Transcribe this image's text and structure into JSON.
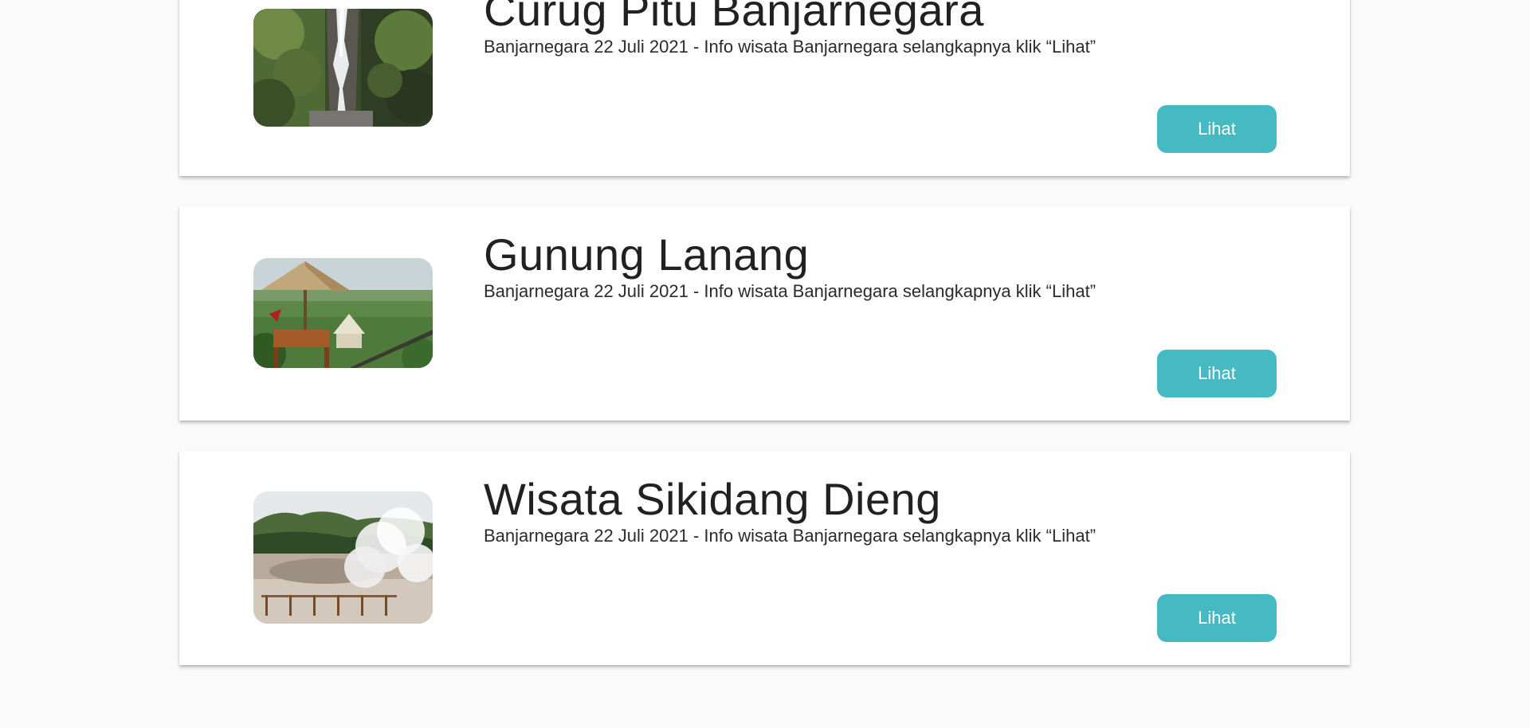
{
  "colors": {
    "page_background": "#fafafa",
    "card_background": "#ffffff",
    "button_background": "#45bac2",
    "button_text": "#ffffff",
    "title_text": "#212121"
  },
  "cards": [
    {
      "title": "Curug Pitu Banjarnegara",
      "subtitle": "Banjarnegara 22 Juli 2021 - Info wisata Banjarnegara selangkapnya klik “Lihat”",
      "button_label": "Lihat",
      "image_subject": "waterfall"
    },
    {
      "title": "Gunung Lanang",
      "subtitle": "Banjarnegara 22 Juli 2021 - Info wisata Banjarnegara selangkapnya klik “Lihat”",
      "button_label": "Lihat",
      "image_subject": "thatched-gazebo-viewpoint"
    },
    {
      "title": "Wisata Sikidang Dieng",
      "subtitle": "Banjarnegara 22 Juli 2021 - Info wisata Banjarnegara selangkapnya klik “Lihat”",
      "button_label": "Lihat",
      "image_subject": "steaming-crater"
    }
  ]
}
